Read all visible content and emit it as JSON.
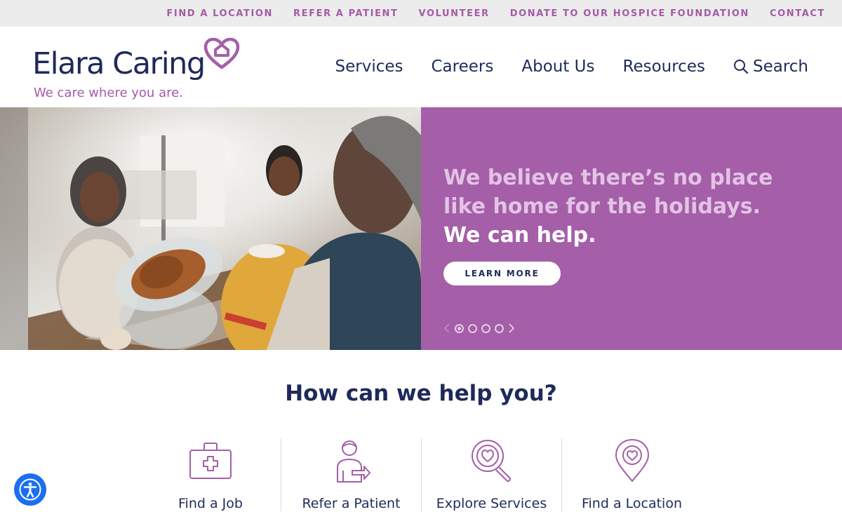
{
  "utility_nav": {
    "links": [
      "FIND A LOCATION",
      "REFER A PATIENT",
      "VOLUNTEER",
      "DONATE TO OUR HOSPICE FOUNDATION",
      "CONTACT"
    ]
  },
  "logo": {
    "name": "Elara Caring",
    "tagline": "We care where you are."
  },
  "main_nav": {
    "services": "Services",
    "careers": "Careers",
    "about": "About Us",
    "resources": "Resources",
    "search": "Search"
  },
  "hero": {
    "heading_line1": "We believe there’s no place like home for the holidays.",
    "heading_strong": "We can help.",
    "cta": "LEARN MORE",
    "slides_total": 4,
    "active_slide": 1
  },
  "help": {
    "heading": "How can we help you?",
    "items": [
      {
        "label": "Find a Job",
        "icon": "medical-kit-icon"
      },
      {
        "label": "Refer a Patient",
        "icon": "refer-person-icon"
      },
      {
        "label": "Explore Services",
        "icon": "magnifier-heart-icon"
      },
      {
        "label": "Find a Location",
        "icon": "location-heart-icon"
      }
    ]
  },
  "colors": {
    "brand_purple": "#a45fa8",
    "brand_navy": "#1f2a5a",
    "accessibility_blue": "#1c6ef2"
  }
}
